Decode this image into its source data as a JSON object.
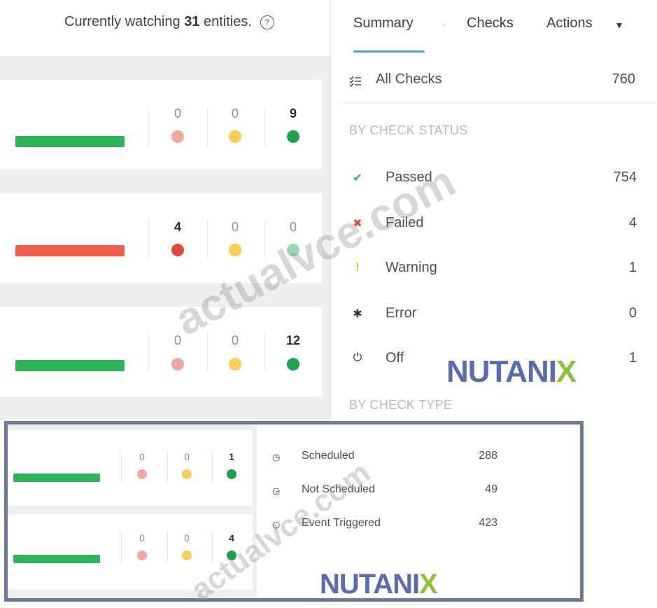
{
  "header": {
    "watching_prefix": "Currently watching",
    "watching_count": "31",
    "watching_suffix": "entities.",
    "help_glyph": "?"
  },
  "tabs": [
    {
      "label": "Summary",
      "active": true
    },
    {
      "label": "Checks",
      "active": false
    },
    {
      "label": "Actions",
      "active": false
    }
  ],
  "tab_separator": "·",
  "actions_caret": "▾",
  "all_checks": {
    "icon": "list-icon",
    "label": "All Checks",
    "value": "760"
  },
  "by_check_status": {
    "heading": "BY CHECK STATUS",
    "items": [
      {
        "icon": "checkmark-icon",
        "glyph": "✔",
        "color": "#2fb45a",
        "label": "Passed",
        "value": "754"
      },
      {
        "icon": "cross-icon",
        "glyph": "✖",
        "color": "#e04a3a",
        "label": "Failed",
        "value": "4"
      },
      {
        "icon": "exclamation-icon",
        "glyph": "!",
        "color": "#f2b91c",
        "label": "Warning",
        "value": "1"
      },
      {
        "icon": "bug-icon",
        "glyph": "✱",
        "color": "#333333",
        "label": "Error",
        "value": "0"
      },
      {
        "icon": "power-icon",
        "glyph": "⏻",
        "color": "#333333",
        "label": "Off",
        "value": "1"
      }
    ]
  },
  "by_check_type": {
    "heading": "BY CHECK TYPE",
    "items": [
      {
        "icon": "clock-icon",
        "glyph": "◷",
        "label": "Scheduled",
        "value": "288"
      },
      {
        "icon": "not-scheduled-icon",
        "glyph": "◶",
        "label": "Not Scheduled",
        "value": "49"
      },
      {
        "icon": "event-icon",
        "glyph": "◵",
        "label": "Event Triggered",
        "value": "423"
      }
    ]
  },
  "entities": [
    {
      "bar_color": "green",
      "counts": [
        "0",
        "0",
        "9"
      ]
    },
    {
      "bar_color": "red",
      "counts": [
        "4",
        "0",
        "0"
      ]
    },
    {
      "bar_color": "green",
      "counts": [
        "0",
        "0",
        "12"
      ]
    }
  ],
  "inset_entities": [
    {
      "bar_color": "green",
      "counts": [
        "0",
        "0",
        "1"
      ]
    },
    {
      "bar_color": "green",
      "counts": [
        "0",
        "0",
        "4"
      ]
    }
  ],
  "brand": {
    "text_main": "NUTANI",
    "text_x": "X"
  },
  "watermark": "actualvce.com",
  "colors": {
    "accent": "#4aa3d8",
    "green": "#2fb45a",
    "red": "#e04a3a",
    "yellow": "#f6cf5a",
    "brand": "#5a6bb0"
  }
}
